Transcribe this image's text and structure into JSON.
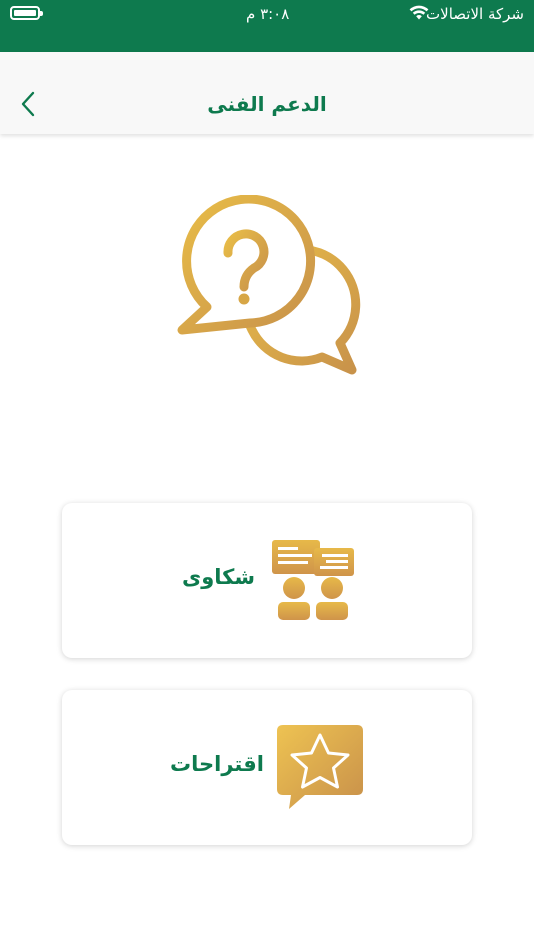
{
  "status_bar": {
    "carrier": "شركة الاتصالات",
    "time": "٣:٠٨ م"
  },
  "nav": {
    "title": "الدعم الفنى",
    "back_icon": "chevron-left-icon"
  },
  "hero": {
    "icon": "question-chat-bubbles-icon"
  },
  "options": [
    {
      "label": "شكاوى",
      "icon": "complaints-people-chat-icon"
    },
    {
      "label": "اقتراحات",
      "icon": "star-speech-bubble-icon"
    }
  ],
  "colors": {
    "brand": "#0e7a4e",
    "gold_light": "#e8bc48",
    "gold_dark": "#c8924a"
  }
}
